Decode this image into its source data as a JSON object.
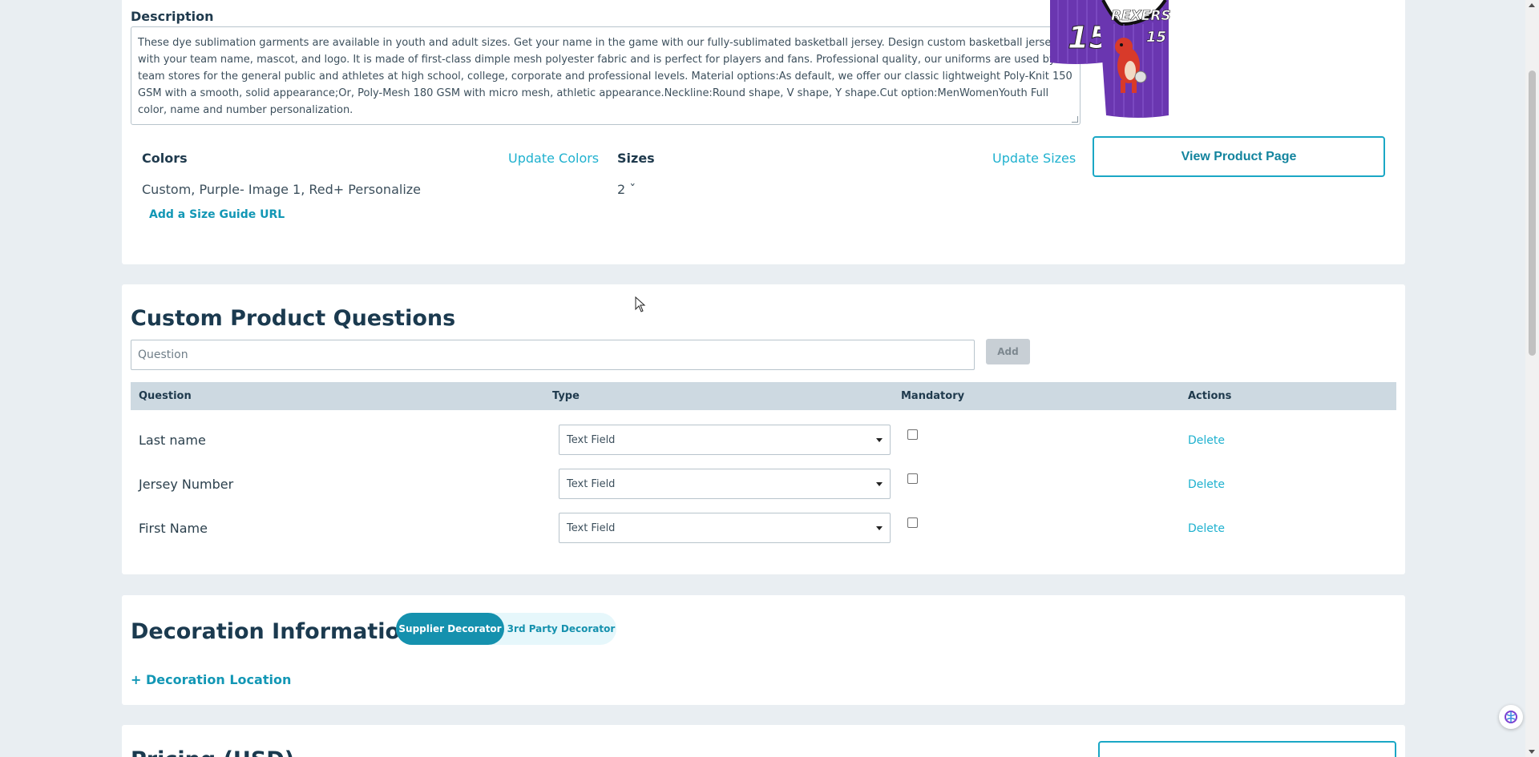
{
  "description": {
    "label": "Description",
    "text": "These dye sublimation garments are available in youth and adult sizes. Get your name in the game with our fully-sublimated basketball jersey. Design custom basketball jerseys with your team name, mascot, and logo. It is made of first-class dimple mesh polyester fabric and is perfect for players and fans. Professional quality, our uniforms are used by team stores for the general public and athletes at high school, college, corporate and professional levels. Material options:As default, we offer our classic lightweight Poly-Knit 150 GSM with a smooth, solid appearance;Or, Poly-Mesh 180 GSM with micro mesh, athletic appearance.Neckline:Round shape, V shape, Y shape.Cut option:MenWomenYouth Full color, name and number personalization."
  },
  "product_image": {
    "front_number": "15",
    "back_text": "REXERS",
    "back_number": "15",
    "color": "#6a36b0"
  },
  "view_product_label": "View Product Page",
  "colors": {
    "heading": "Colors",
    "update_label": "Update Colors",
    "value": "Custom, Purple- Image 1, Red+ Personalize"
  },
  "sizes": {
    "heading": "Sizes",
    "update_label": "Update Sizes",
    "value": "2 ˇ"
  },
  "size_guide_label": "Add a Size Guide URL",
  "questions": {
    "title": "Custom Product Questions",
    "input_placeholder": "Question",
    "add_label": "Add",
    "headers": {
      "question": "Question",
      "type": "Type",
      "mandatory": "Mandatory",
      "actions": "Actions"
    },
    "rows": [
      {
        "question": "Last name",
        "type": "Text Field",
        "mandatory": false,
        "action": "Delete"
      },
      {
        "question": "Jersey Number",
        "type": "Text Field",
        "mandatory": false,
        "action": "Delete"
      },
      {
        "question": "First Name",
        "type": "Text Field",
        "mandatory": false,
        "action": "Delete"
      }
    ]
  },
  "decoration": {
    "title": "Decoration Information",
    "toggle_selected": "Supplier Decorator",
    "toggle_other": "3rd Party Decorator",
    "add_location_label": "+ Decoration Location"
  },
  "pricing": {
    "title": "Pricing (USD)"
  },
  "colors_theme": {
    "accent": "#1aa7c5",
    "heading": "#1b3a4f",
    "table_header_bg": "#cdd9e1",
    "page_bg": "#e9eef2"
  }
}
